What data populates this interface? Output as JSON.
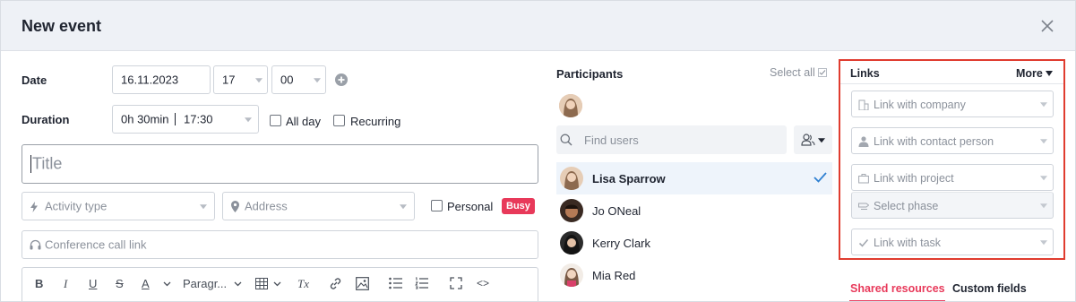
{
  "header": {
    "title": "New event"
  },
  "form": {
    "date_label": "Date",
    "date_value": "16.11.2023",
    "hour_value": "17",
    "minute_value": "00",
    "duration_label": "Duration",
    "duration_value": "0h 30min",
    "duration_end": "17:30",
    "allday_label": "All day",
    "recurring_label": "Recurring",
    "title_placeholder": "Title",
    "activity_placeholder": "Activity type",
    "address_placeholder": "Address",
    "personal_label": "Personal",
    "busy_badge": "Busy",
    "conference_placeholder": "Conference call link",
    "editor": {
      "bold": "B",
      "italic": "I",
      "underline": "U",
      "strike": "S",
      "textcolor": "A",
      "paragraph": "Paragr...",
      "clear": "Tx",
      "code": "<>"
    }
  },
  "participants": {
    "title": "Participants",
    "select_all": "Select all",
    "find_placeholder": "Find users",
    "items": [
      {
        "name": "Lisa Sparrow",
        "selected": true
      },
      {
        "name": "Jo ONeal",
        "selected": false
      },
      {
        "name": "Kerry Clark",
        "selected": false
      },
      {
        "name": "Mia Red",
        "selected": false
      }
    ]
  },
  "links": {
    "title": "Links",
    "more": "More",
    "company": "Link with company",
    "contact": "Link with contact person",
    "project": "Link with project",
    "phase": "Select phase",
    "task": "Link with task"
  },
  "tabs": {
    "shared": "Shared resources",
    "custom": "Custom fields"
  },
  "colors": {
    "accent": "#e8395a",
    "check": "#2f80d1",
    "highlight": "#e03c2f"
  }
}
